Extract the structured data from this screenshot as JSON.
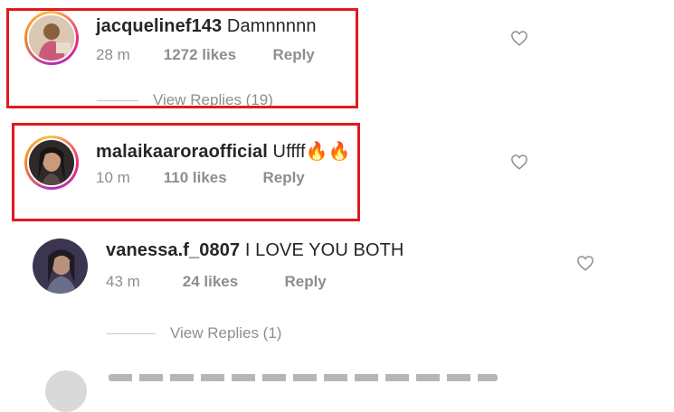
{
  "comments": [
    {
      "username": "jacquelinef143",
      "text": "Damnnnnn",
      "time": "28 m",
      "likes": "1272 likes",
      "reply": "Reply",
      "view_replies": "View Replies (19)"
    },
    {
      "username": "malaikaaroraofficial",
      "text": "Uffff🔥🔥",
      "time": "10 m",
      "likes": "110 likes",
      "reply": "Reply"
    },
    {
      "username": "vanessa.f_0807",
      "text": "I LOVE YOU BOTH",
      "time": "43 m",
      "likes": "24 likes",
      "reply": "Reply",
      "view_replies": "View Replies (1)"
    }
  ],
  "colors": {
    "highlight": "#e0191f",
    "meta_gray": "#8e8e8e",
    "text": "#262626"
  },
  "icons": {
    "like": "heart-outline-icon"
  }
}
